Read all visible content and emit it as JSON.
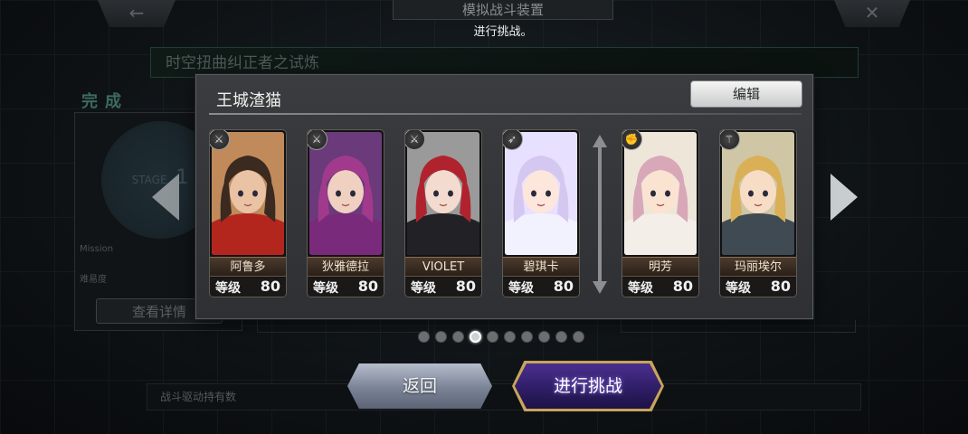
{
  "header": {
    "title": "模拟战斗装置",
    "subtitle": "进行挑战。",
    "back_icon": "←",
    "close_icon": "✕"
  },
  "background": {
    "banner": "时空扭曲纠正者之试炼",
    "complete": "完成",
    "stage_label": "STAGE",
    "stage_num": "1",
    "mission": "Mission",
    "difficulty": "难易度",
    "detail_button": "查看详情",
    "bottom_text": "战斗驱动持有数"
  },
  "modal": {
    "team_name": "王城渣猫",
    "edit_label": "编辑",
    "level_label": "等级",
    "characters": [
      {
        "name": "阿鲁多",
        "level": "80",
        "class_icon": "sword-icon",
        "hair": "#3a2a20",
        "outfit": "#b3261e",
        "skin": "#e9c3a4",
        "bg": "#c08a5a"
      },
      {
        "name": "狄雅德拉",
        "level": "80",
        "class_icon": "sword-icon",
        "hair": "#a13a8c",
        "outfit": "#7a2a7a",
        "skin": "#f0d0c0",
        "bg": "#6a3a7a"
      },
      {
        "name": "VIOLET",
        "level": "80",
        "class_icon": "sword-icon",
        "hair": "#b0232e",
        "outfit": "#222226",
        "skin": "#f3dccf",
        "bg": "#9a9a9a"
      },
      {
        "name": "碧琪卡",
        "level": "80",
        "class_icon": "bow-icon",
        "hair": "#d4c8f0",
        "outfit": "#f2f2ff",
        "skin": "#fde6dc",
        "bg": "#e8e0ff"
      },
      {
        "name": "明芳",
        "level": "80",
        "class_icon": "fist-icon",
        "hair": "#d8a8b8",
        "outfit": "#f3efe8",
        "skin": "#fbe3d2",
        "bg": "#efe6da"
      },
      {
        "name": "玛丽埃尔",
        "level": "80",
        "class_icon": "staff-icon",
        "hair": "#d9b055",
        "outfit": "#3f4a52",
        "skin": "#f7dcc6",
        "bg": "#cfc6a6"
      }
    ]
  },
  "pager": {
    "count": 10,
    "active": 3
  },
  "footer": {
    "back_label": "返回",
    "challenge_label": "进行挑战"
  }
}
